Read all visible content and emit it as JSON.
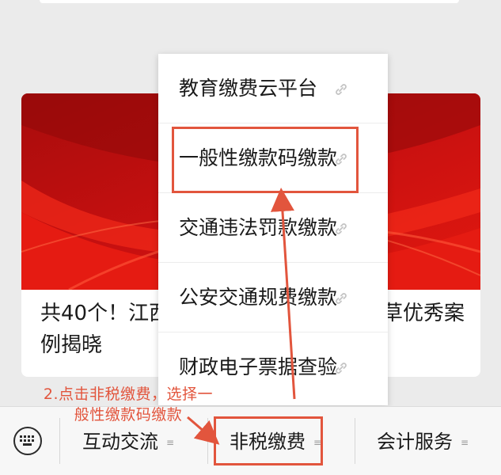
{
  "article": {
    "title_left": "共40个！江西",
    "title_right": "草优秀案",
    "title_line2": "例揭晓"
  },
  "popup_menu": {
    "items": [
      {
        "label": "教育缴费云平台",
        "icon": "link-icon"
      },
      {
        "label": "一般性缴款码缴款",
        "icon": "link-icon"
      },
      {
        "label": "交通违法罚款缴款",
        "icon": "link-icon"
      },
      {
        "label": "公安交通规费缴款",
        "icon": "link-icon"
      },
      {
        "label": "财政电子票据查验",
        "icon": "link-icon"
      }
    ]
  },
  "bottom_menu": {
    "keyboard_icon": "keyboard-icon",
    "tabs": [
      {
        "label": "互动交流",
        "icon": "menu-lines-icon"
      },
      {
        "label": "非税缴费",
        "icon": "menu-lines-icon"
      },
      {
        "label": "会计服务",
        "icon": "menu-lines-icon"
      }
    ]
  },
  "annotation": {
    "line1": "2.点击非税缴费，选择一",
    "line2": "般性缴款码缴款",
    "color": "#e2553d"
  },
  "colors": {
    "banner_red": "#d8150f",
    "banner_dark": "#8e0a0a",
    "highlight": "#e2553d"
  }
}
